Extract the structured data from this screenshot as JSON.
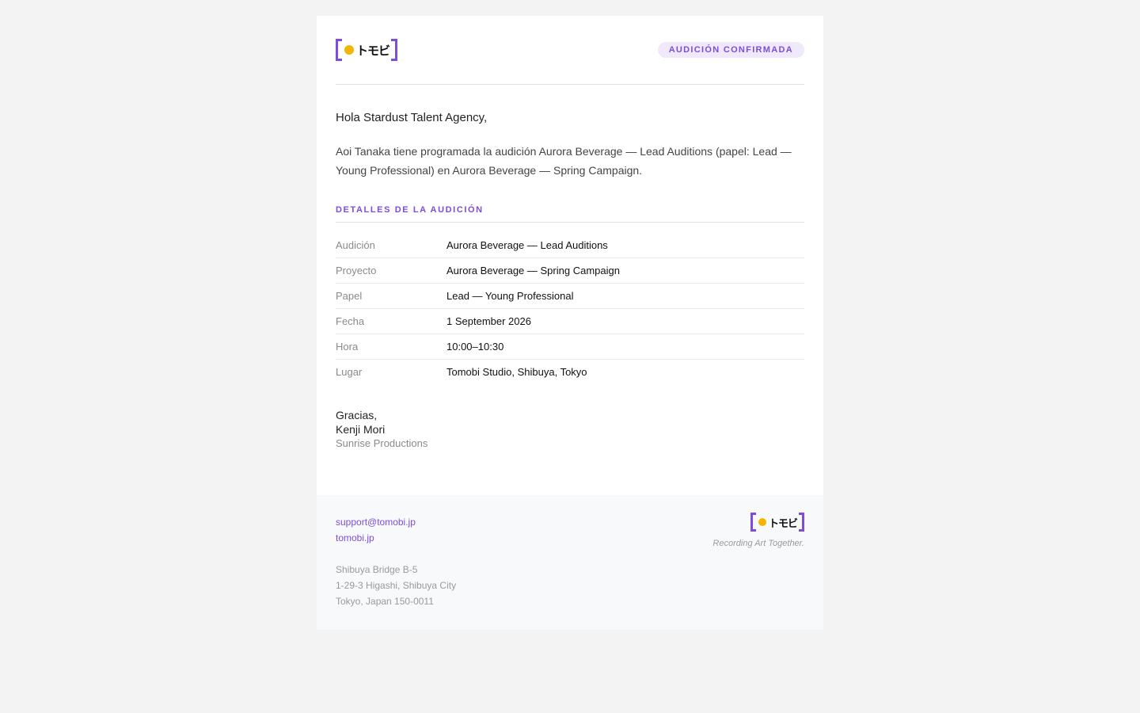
{
  "brand": {
    "logo_text": "トモビ",
    "colors": {
      "accent": "#7c4ddc",
      "dot": "#f5b400"
    }
  },
  "header": {
    "badge": "AUDICIÓN CONFIRMADA"
  },
  "body": {
    "greeting": "Hola Stardust Talent Agency,",
    "intro": "Aoi Tanaka tiene programada la audición Aurora Beverage — Lead Auditions (papel: Lead — Young Professional) en Aurora Beverage — Spring Campaign."
  },
  "details": {
    "title": "DETALLES DE LA AUDICIÓN",
    "rows": [
      {
        "label": "Audición",
        "value": "Aurora Beverage — Lead Auditions"
      },
      {
        "label": "Proyecto",
        "value": "Aurora Beverage — Spring Campaign"
      },
      {
        "label": "Papel",
        "value": "Lead — Young Professional"
      },
      {
        "label": "Fecha",
        "value": "1 September 2026"
      },
      {
        "label": "Hora",
        "value": "10:00–10:30"
      },
      {
        "label": "Lugar",
        "value": "Tomobi Studio, Shibuya, Tokyo"
      }
    ]
  },
  "signoff": {
    "closing": "Gracias,",
    "name": "Kenji Mori",
    "company": "Sunrise Productions"
  },
  "footer": {
    "email": "support@tomobi.jp",
    "website": "tomobi.jp",
    "address": [
      "Shibuya Bridge B-5",
      "1-29-3 Higashi, Shibuya City",
      "Tokyo, Japan 150-0011"
    ],
    "tagline": "Recording Art Together."
  }
}
